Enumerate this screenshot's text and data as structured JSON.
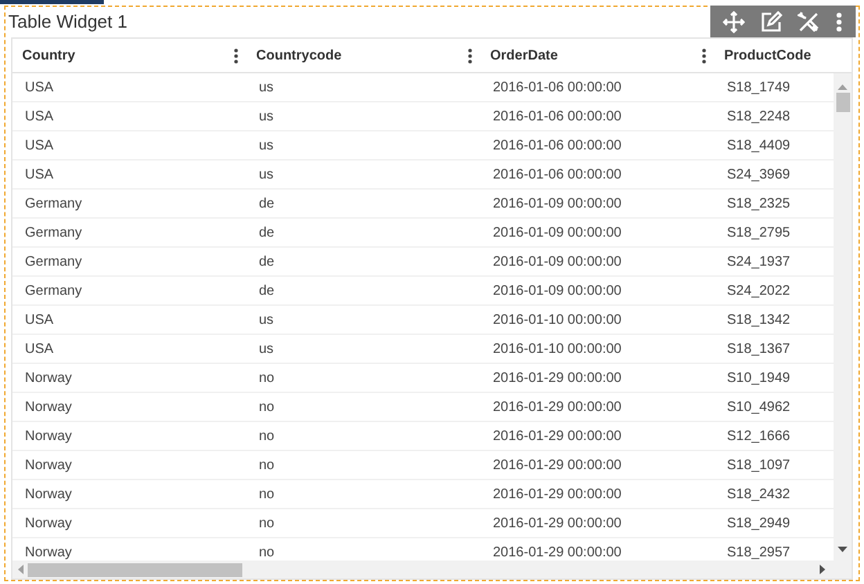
{
  "widget": {
    "title": "Table Widget 1"
  },
  "table": {
    "columns": [
      "Country",
      "Countrycode",
      "OrderDate",
      "ProductCode"
    ],
    "rows": [
      [
        "USA",
        "us",
        "2016-01-06 00:00:00",
        "S18_1749"
      ],
      [
        "USA",
        "us",
        "2016-01-06 00:00:00",
        "S18_2248"
      ],
      [
        "USA",
        "us",
        "2016-01-06 00:00:00",
        "S18_4409"
      ],
      [
        "USA",
        "us",
        "2016-01-06 00:00:00",
        "S24_3969"
      ],
      [
        "Germany",
        "de",
        "2016-01-09 00:00:00",
        "S18_2325"
      ],
      [
        "Germany",
        "de",
        "2016-01-09 00:00:00",
        "S18_2795"
      ],
      [
        "Germany",
        "de",
        "2016-01-09 00:00:00",
        "S24_1937"
      ],
      [
        "Germany",
        "de",
        "2016-01-09 00:00:00",
        "S24_2022"
      ],
      [
        "USA",
        "us",
        "2016-01-10 00:00:00",
        "S18_1342"
      ],
      [
        "USA",
        "us",
        "2016-01-10 00:00:00",
        "S18_1367"
      ],
      [
        "Norway",
        "no",
        "2016-01-29 00:00:00",
        "S10_1949"
      ],
      [
        "Norway",
        "no",
        "2016-01-29 00:00:00",
        "S10_4962"
      ],
      [
        "Norway",
        "no",
        "2016-01-29 00:00:00",
        "S12_1666"
      ],
      [
        "Norway",
        "no",
        "2016-01-29 00:00:00",
        "S18_1097"
      ],
      [
        "Norway",
        "no",
        "2016-01-29 00:00:00",
        "S18_2432"
      ],
      [
        "Norway",
        "no",
        "2016-01-29 00:00:00",
        "S18_2949"
      ],
      [
        "Norway",
        "no",
        "2016-01-29 00:00:00",
        "S18_2957"
      ]
    ]
  }
}
